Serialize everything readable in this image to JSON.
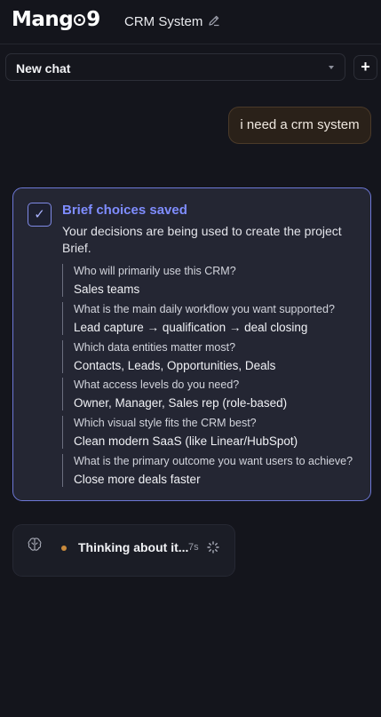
{
  "header": {
    "brand_pre": "Mang",
    "brand_post": "9",
    "project_title": "CRM System",
    "edit_icon": "pencil-icon"
  },
  "chat_selector": {
    "value": "New chat",
    "new_button_label": "+"
  },
  "messages": {
    "user_message": "i need a crm system"
  },
  "brief": {
    "check_glyph": "✓",
    "title": "Brief choices saved",
    "description": "Your decisions are being used to create the project Brief.",
    "items": [
      {
        "question": "Who will primarily use this CRM?",
        "answer": "Sales teams"
      },
      {
        "question": "What is the main daily workflow you want supported?",
        "answer": "Lead capture → qualification → deal closing"
      },
      {
        "question": "Which data entities matter most?",
        "answer": "Contacts, Leads, Opportunities, Deals"
      },
      {
        "question": "What access levels do you need?",
        "answer": "Owner, Manager, Sales rep (role-based)"
      },
      {
        "question": "Which visual style fits the CRM best?",
        "answer": "Clean modern SaaS (like Linear/HubSpot)"
      },
      {
        "question": "What is the primary outcome you want users to achieve?",
        "answer": "Close more deals faster"
      }
    ]
  },
  "thinking": {
    "label": "Thinking about it...",
    "elapsed": "7s",
    "icon": "brain-icon",
    "status_color": "#c98a3c"
  },
  "colors": {
    "accent": "#7f8dff",
    "card_border": "#6d78d6",
    "user_bubble_bg": "#2a2119"
  }
}
